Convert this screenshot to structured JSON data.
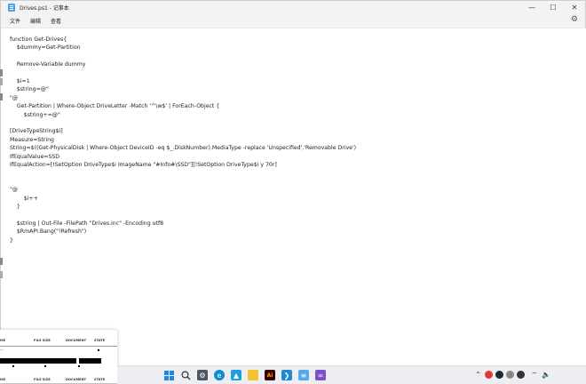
{
  "window": {
    "title": "Drives.ps1 - 记事本",
    "controls": {
      "minimize": "—",
      "maximize": "☐",
      "close": "✕"
    }
  },
  "menu": [
    "文件",
    "编辑",
    "查看"
  ],
  "editor": {
    "lines": [
      "function Get-Drives{",
      "    $dummy=Get-Partition",
      "",
      "    Remove-Variable dummy",
      "",
      "    $i=1",
      "    $string=@\"",
      "\"@",
      "    Get-Partition | Where-Object DriveLetter -Match '^\\w$' | ForEach-Object {",
      "        $string+=@\"",
      "",
      "[DriveTypeString$i]",
      "Measure=String",
      "String=$((Get-PhysicalDisk | Where-Object DeviceID -eq $_.DiskNumber).MediaType -replace 'Unspecified','Removable Drive')",
      "IfEqualValue=SSD",
      "IfEqualAction=[!SetOption DriveType$i ImageName \"#Info#\\SSD\"][!SetOption DriveType$i y 70r]",
      "",
      "",
      "\"@",
      "        $i++",
      "    }",
      "",
      "    $string | Out-File -FilePath \"Drives.inc\" -Encoding utf8",
      "    $RmAPI.Bang(\"!Refresh\")",
      "}"
    ]
  },
  "preview": {
    "headers": [
      "ME",
      "FILE SIZE",
      "DOCUMENT",
      "STATE"
    ],
    "row_mark": "—",
    "header2": [
      "ME",
      "FILE SIZE",
      "DOCUMENT",
      "STATE"
    ]
  },
  "taskbar": {
    "icons": [
      "windows-start-icon",
      "search-icon",
      "settings-icon",
      "edge-icon",
      "photos-icon",
      "file-explorer-icon",
      "adobe-illustrator-icon",
      "vscode-icon",
      "notepad-icon",
      "visual-studio-icon"
    ],
    "tray": [
      "chevron-up-icon",
      "app-red-icon",
      "steam-icon",
      "app-gray-icon",
      "app-dark-icon",
      "network-icon",
      "volume-icon"
    ]
  },
  "colors": {
    "titlebar": "#f3f3f3",
    "taskbar": "#eceef2",
    "accent": "#0067c0"
  }
}
